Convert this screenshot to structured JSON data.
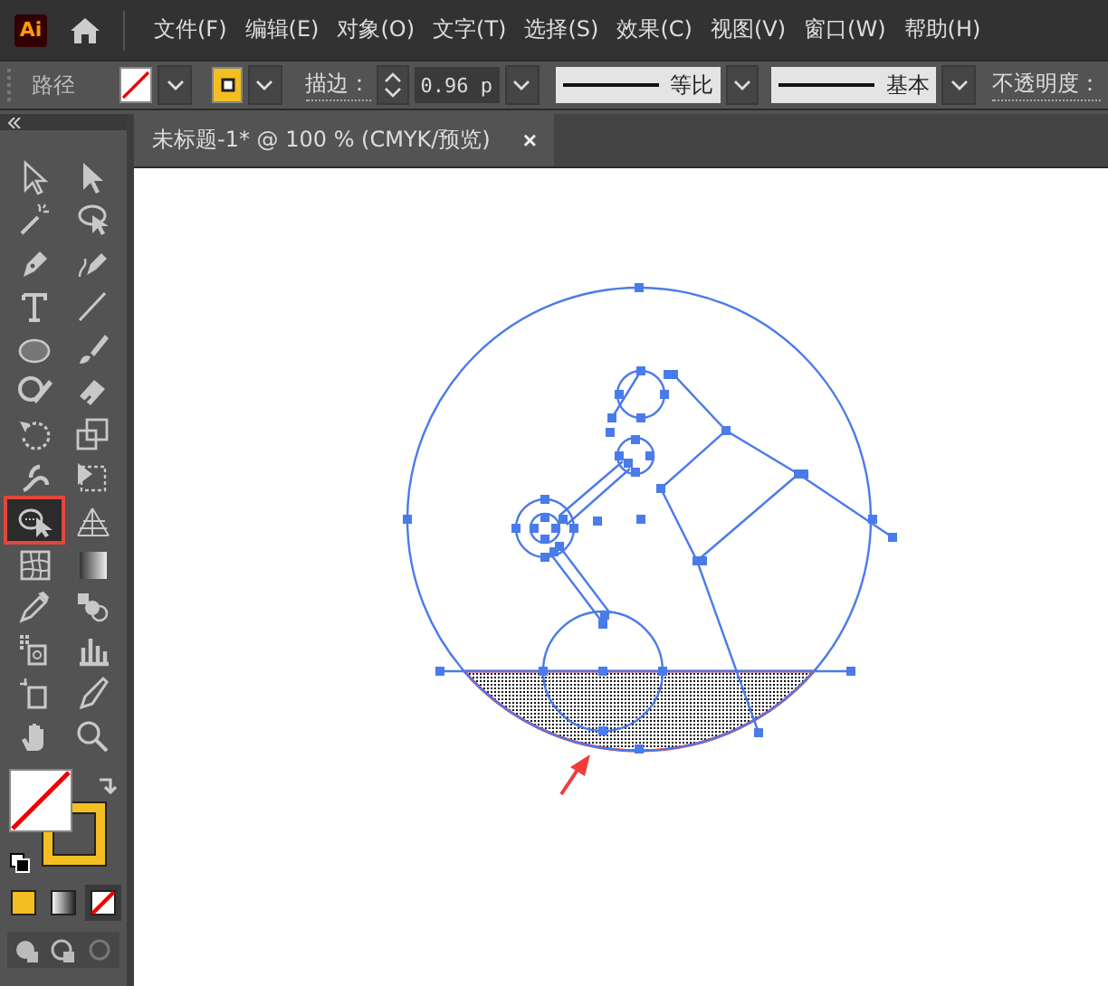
{
  "app": {
    "logo": "Ai"
  },
  "menu": [
    "文件(F)",
    "编辑(E)",
    "对象(O)",
    "文字(T)",
    "选择(S)",
    "效果(C)",
    "视图(V)",
    "窗口(W)",
    "帮助(H)"
  ],
  "control_bar": {
    "selection": "路径",
    "stroke_label": "描边：",
    "stroke_weight": "0.96 p",
    "profile": "等比",
    "brush": "基本",
    "opacity_label": "不透明度："
  },
  "document_tab": {
    "title": "未标题-1* @ 100 % (CMYK/预览)",
    "close": "×"
  },
  "tools": [
    {
      "kind": "select",
      "selected": false
    },
    {
      "kind": "direct",
      "selected": false
    },
    {
      "kind": "wand",
      "selected": false
    },
    {
      "kind": "lasso",
      "selected": false
    },
    {
      "kind": "pen",
      "selected": false
    },
    {
      "kind": "curvature",
      "selected": false
    },
    {
      "kind": "type",
      "selected": false
    },
    {
      "kind": "line",
      "selected": false
    },
    {
      "kind": "ellipse",
      "selected": false
    },
    {
      "kind": "brush",
      "selected": false
    },
    {
      "kind": "blob",
      "selected": false
    },
    {
      "kind": "eraser",
      "selected": false
    },
    {
      "kind": "rotate",
      "selected": false
    },
    {
      "kind": "scale",
      "selected": false
    },
    {
      "kind": "warp",
      "selected": false
    },
    {
      "kind": "freetransform",
      "selected": false
    },
    {
      "kind": "shapebuilder",
      "selected": true
    },
    {
      "kind": "perspective",
      "selected": false
    },
    {
      "kind": "mesh",
      "selected": false
    },
    {
      "kind": "gradient",
      "selected": false
    },
    {
      "kind": "eyedropper",
      "selected": false
    },
    {
      "kind": "blend",
      "selected": false
    },
    {
      "kind": "spray",
      "selected": false
    },
    {
      "kind": "graph",
      "selected": false
    },
    {
      "kind": "artboard",
      "selected": false
    },
    {
      "kind": "slice",
      "selected": false
    },
    {
      "kind": "hand",
      "selected": false
    },
    {
      "kind": "zoom",
      "selected": false
    }
  ],
  "color_modes": [
    {
      "kind": "color",
      "selected": false
    },
    {
      "kind": "gradient",
      "selected": false
    },
    {
      "kind": "none",
      "selected": true
    }
  ]
}
